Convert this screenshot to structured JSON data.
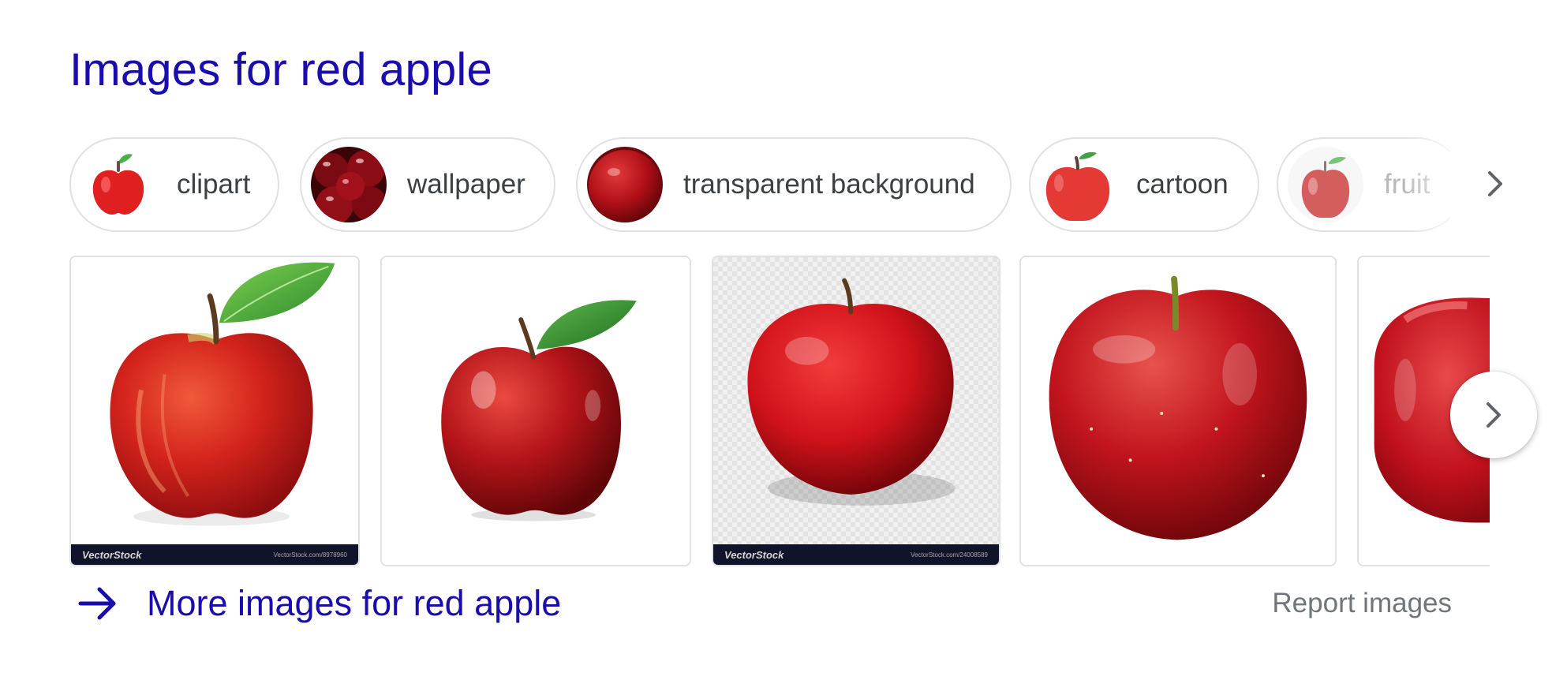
{
  "heading": "Images for red apple",
  "chips": [
    {
      "label": "clipart",
      "thumb_icon": "apple-clipart-icon"
    },
    {
      "label": "wallpaper",
      "thumb_icon": "cherries-photo-icon"
    },
    {
      "label": "transparent background",
      "thumb_icon": "red-apple-photo-icon"
    },
    {
      "label": "cartoon",
      "thumb_icon": "apple-cartoon-icon"
    },
    {
      "label": "fruit",
      "thumb_icon": "apple-photo-icon"
    }
  ],
  "images": [
    {
      "subject": "red apple with green leaf",
      "watermark_brand": "VectorStock",
      "watermark_url": "VectorStock.com/8978960"
    },
    {
      "subject": "red apple with leaf"
    },
    {
      "subject": "red apple on transparent background",
      "watermark_brand": "VectorStock",
      "watermark_url": "VectorStock.com/24008589"
    },
    {
      "subject": "red apple close-up"
    },
    {
      "subject": "red apple cropped"
    }
  ],
  "more_link": "More images for red apple",
  "report_link": "Report images",
  "colors": {
    "link_blue": "#1a0dab",
    "chip_text": "#3c4043",
    "muted_text": "#70757a",
    "border": "#dfe1e5"
  }
}
